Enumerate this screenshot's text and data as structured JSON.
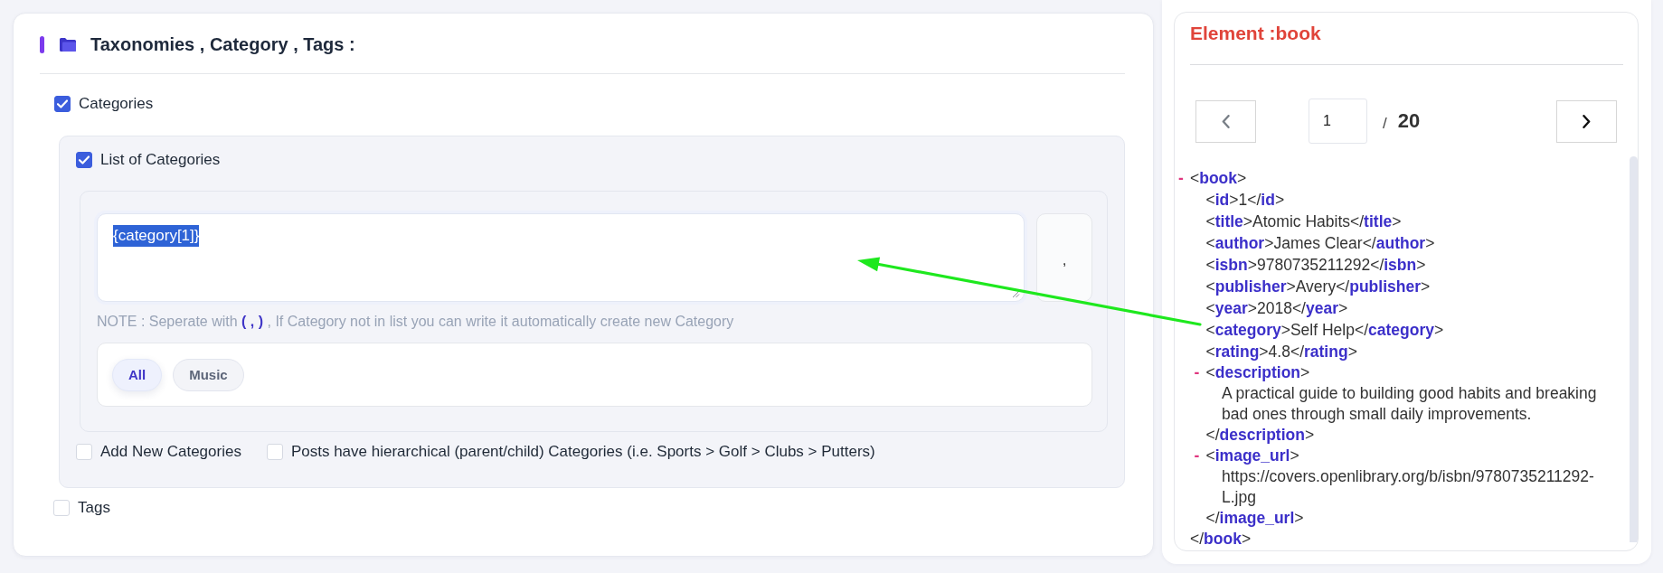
{
  "section": {
    "title": "Taxonomies , Category , Tags :"
  },
  "categories": {
    "label": "Categories",
    "checked": true
  },
  "category_list": {
    "label": "List of Categories",
    "checked": true,
    "value": "{category[1]}",
    "text_selected": true,
    "separator": ",",
    "note": "NOTE : Seperate with **( , )** , If Category not in list you can write it automatically create new Category",
    "chips": [
      {
        "label": "All",
        "selected": true
      },
      {
        "label": "Music",
        "selected": false
      }
    ]
  },
  "category_options": [
    {
      "label": "Add New Categories",
      "checked": false
    },
    {
      "label": "Posts have hierarchical (parent/child) Categories (i.e. Sports > Golf > Clubs > Putters)",
      "checked": false
    }
  ],
  "tags": {
    "label": "Tags",
    "checked": false
  },
  "element_panel": {
    "title": "Element :book",
    "pagination": {
      "prev": {
        "disabled": true
      },
      "page": "1",
      "separator": "/",
      "total": "20",
      "next": {
        "disabled": false
      }
    },
    "xml": {
      "toggle": "-",
      "open": "<**book**>",
      "children": [
        {
          "line": "<**id**>1</**id**>"
        },
        {
          "line": "<**title**>Atomic Habits</**title**>"
        },
        {
          "line": "<**author**>James Clear</**author**>"
        },
        {
          "line": "<**isbn**>9780735211292</**isbn**>"
        },
        {
          "line": "<**publisher**>Avery</**publisher**>"
        },
        {
          "line": "<**year**>2018</**year**>"
        },
        {
          "line": "<**category**>Self Help</**category**>"
        },
        {
          "line": "<**rating**>4.8</**rating**>"
        },
        {
          "toggle": "-",
          "open": "<**description**>",
          "children": [
            {
              "line": "A practical guide to building good habits and breaking bad ones through small daily improvements."
            }
          ],
          "close": "</**description**>"
        },
        {
          "toggle": "-",
          "open": "<**image_url**>",
          "children": [
            {
              "line": "https://covers.openlibrary.org/b/isbn/9780735211292-L.jpg"
            }
          ],
          "close": "</**image_url**>"
        }
      ],
      "close": "</**book**>"
    }
  }
}
